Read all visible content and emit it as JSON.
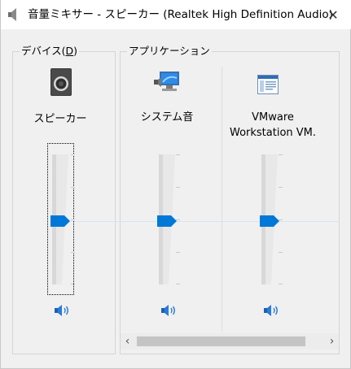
{
  "window": {
    "title": "音量ミキサー - スピーカー (Realtek High Definition Audio)",
    "close_glyph": "✕"
  },
  "device_group": {
    "label_prefix": "デバイス(",
    "label_accel": "D",
    "label_suffix": ")",
    "device": {
      "name": "スピーカー",
      "volume_percent": 45,
      "icon": "speaker-device-icon"
    }
  },
  "app_group": {
    "label": "アプリケーション",
    "apps": [
      {
        "name": "システム音",
        "volume_percent": 45,
        "icon": "system-sounds-icon"
      },
      {
        "name_line1": "VMware",
        "name_line2": "Workstation VM.",
        "volume_percent": 45,
        "icon": "app-window-icon"
      }
    ]
  },
  "scrollbar": {
    "left_glyph": "‹",
    "right_glyph": "›"
  },
  "colors": {
    "accent": "#0078d7",
    "track_fill": "#e6e6e6",
    "line": "#d6e4ee"
  }
}
